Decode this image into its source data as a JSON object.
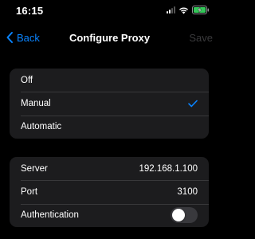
{
  "status_bar": {
    "time": "16:15",
    "icons": [
      "signal-icon",
      "wifi-icon",
      "battery-charging-icon"
    ]
  },
  "nav": {
    "back_label": "Back",
    "title": "Configure Proxy",
    "save_label": "Save"
  },
  "proxy_modes": {
    "options": [
      {
        "label": "Off",
        "selected": false
      },
      {
        "label": "Manual",
        "selected": true
      },
      {
        "label": "Automatic",
        "selected": false
      }
    ]
  },
  "settings": {
    "server": {
      "label": "Server",
      "value": "192.168.1.100"
    },
    "port": {
      "label": "Port",
      "value": "3100"
    },
    "authentication": {
      "label": "Authentication",
      "enabled": false
    }
  },
  "colors": {
    "accent": "#0a84ff",
    "background": "#000000",
    "group_background": "#1c1c1e",
    "separator": "#38383a",
    "disabled_text": "#3a3a3c",
    "toggle_off": "#39393d"
  }
}
